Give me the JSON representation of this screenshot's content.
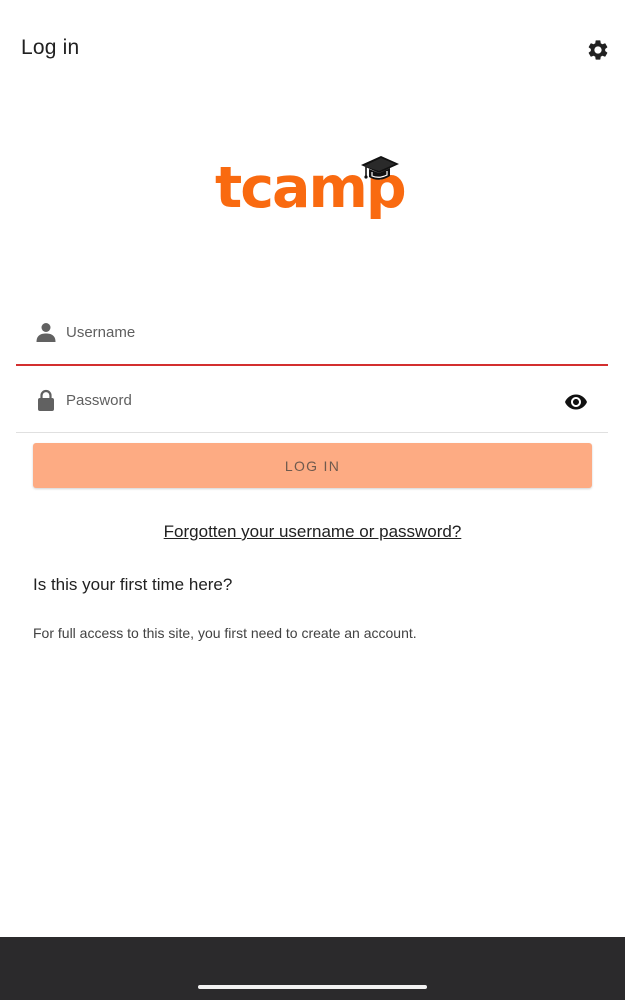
{
  "header": {
    "title": "Log in",
    "settings_icon": "gear-icon"
  },
  "logo": {
    "text": "tcamp",
    "brand_color": "#f96a10"
  },
  "form": {
    "username": {
      "placeholder": "Username",
      "value": "",
      "icon": "user-icon",
      "underline_color": "#d32f2f"
    },
    "password": {
      "placeholder": "Password",
      "value": "",
      "icon": "lock-icon",
      "toggle_icon": "eye-icon"
    },
    "login_label": "LOG IN",
    "login_button_color": "#fdab83"
  },
  "links": {
    "forgot": "Forgotten your username or password?"
  },
  "signup": {
    "heading": "Is this your first time here?",
    "description": "For full access to this site, you first need to create an account."
  },
  "system": {
    "nav_bar_color": "#2b2a2c"
  }
}
